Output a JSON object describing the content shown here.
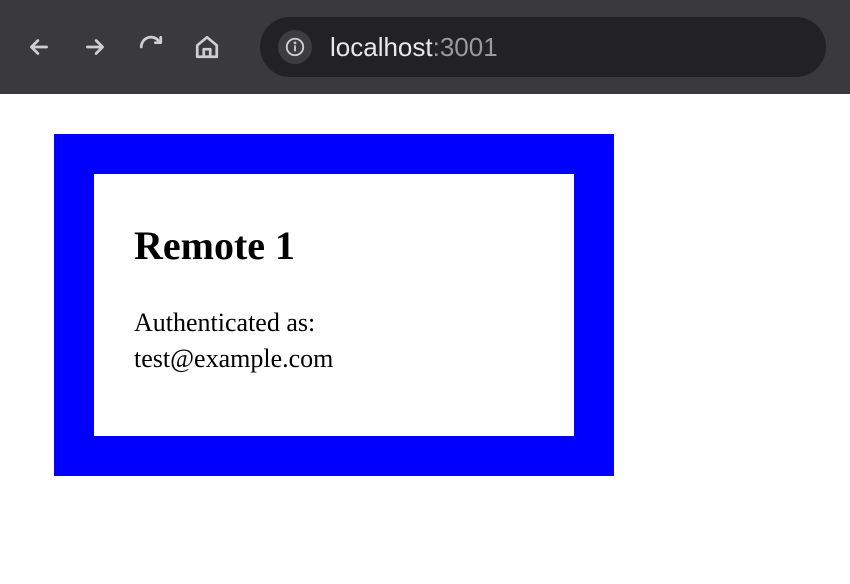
{
  "browser": {
    "url_host": "localhost",
    "url_port": ":3001"
  },
  "page": {
    "heading": "Remote 1",
    "auth_label": "Authenticated as:",
    "auth_email": "test@example.com"
  }
}
